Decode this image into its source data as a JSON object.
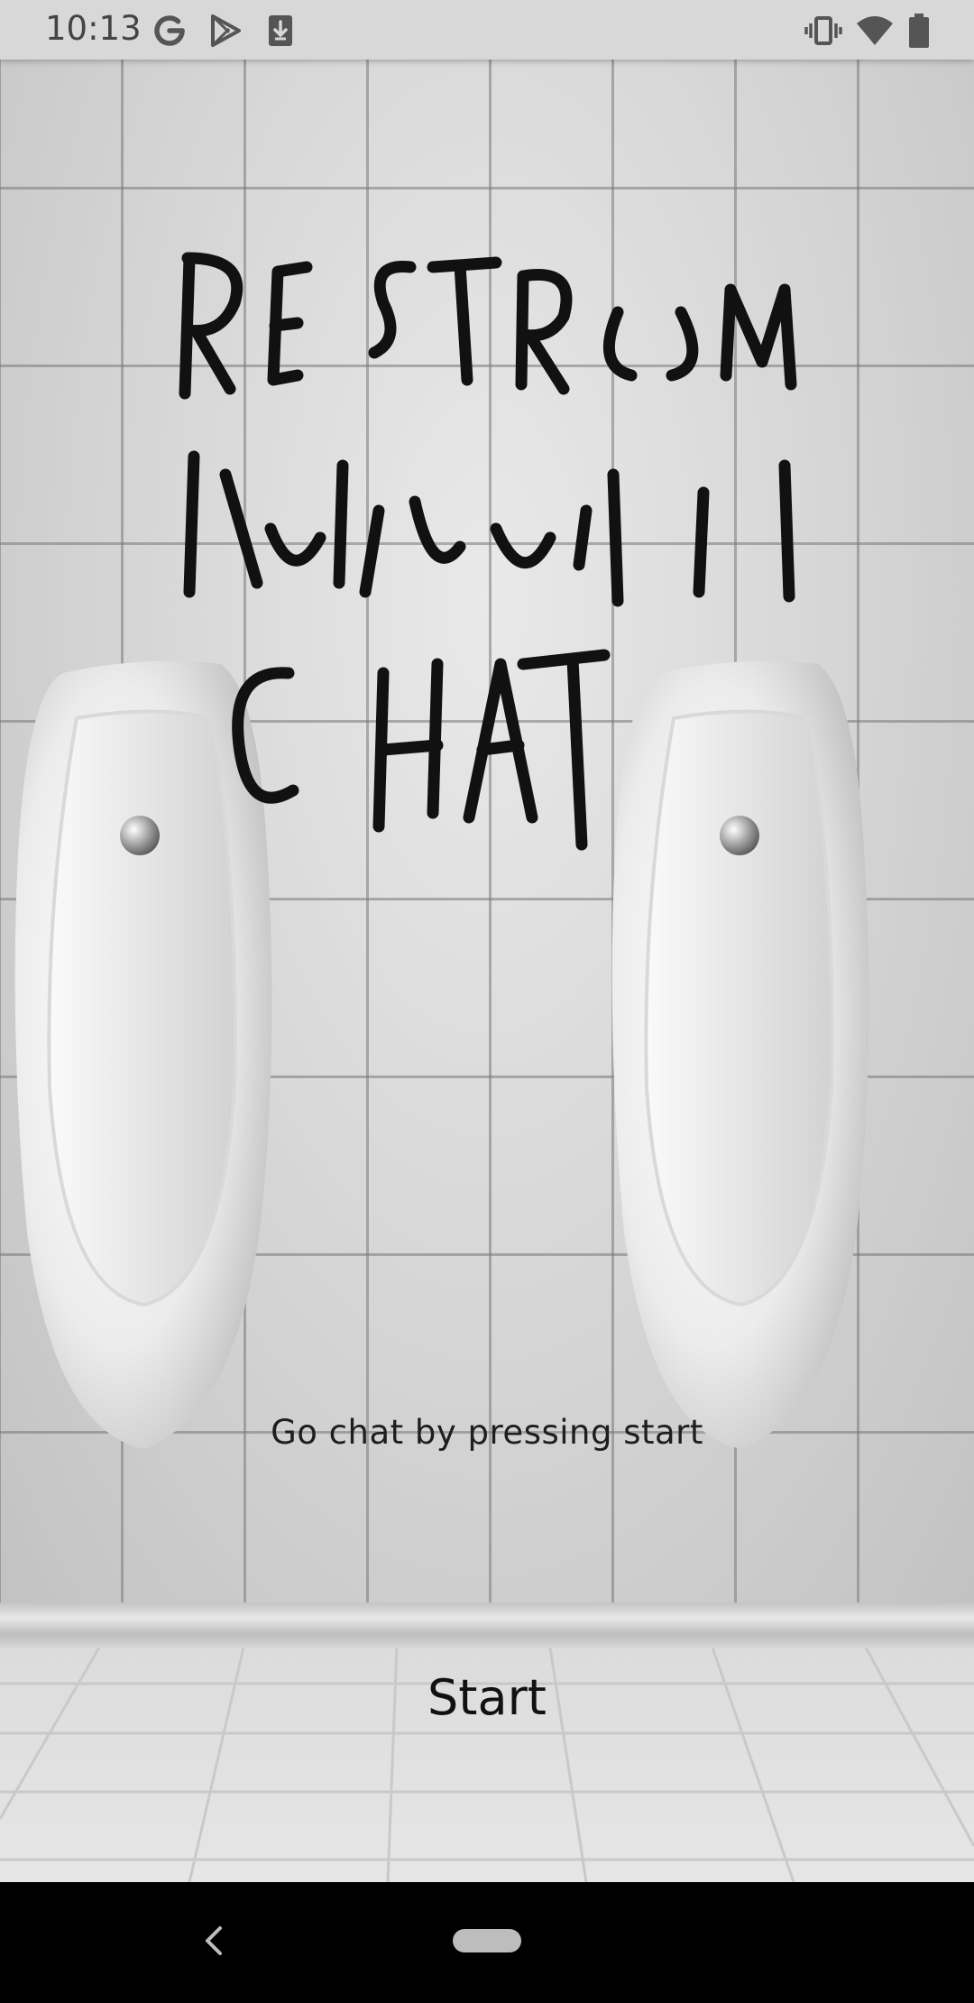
{
  "status_bar": {
    "time": "10:13",
    "left_icons": [
      "google-icon",
      "play-store-icon",
      "download-icon"
    ],
    "right_icons": [
      "vibrate-icon",
      "wifi-icon",
      "battery-icon"
    ]
  },
  "app": {
    "title_art": [
      "RESTROOM",
      "CHAT"
    ],
    "caption": "Go chat by pressing start",
    "start_label": "Start"
  },
  "nav_bar": {
    "buttons": [
      "back",
      "home"
    ]
  }
}
